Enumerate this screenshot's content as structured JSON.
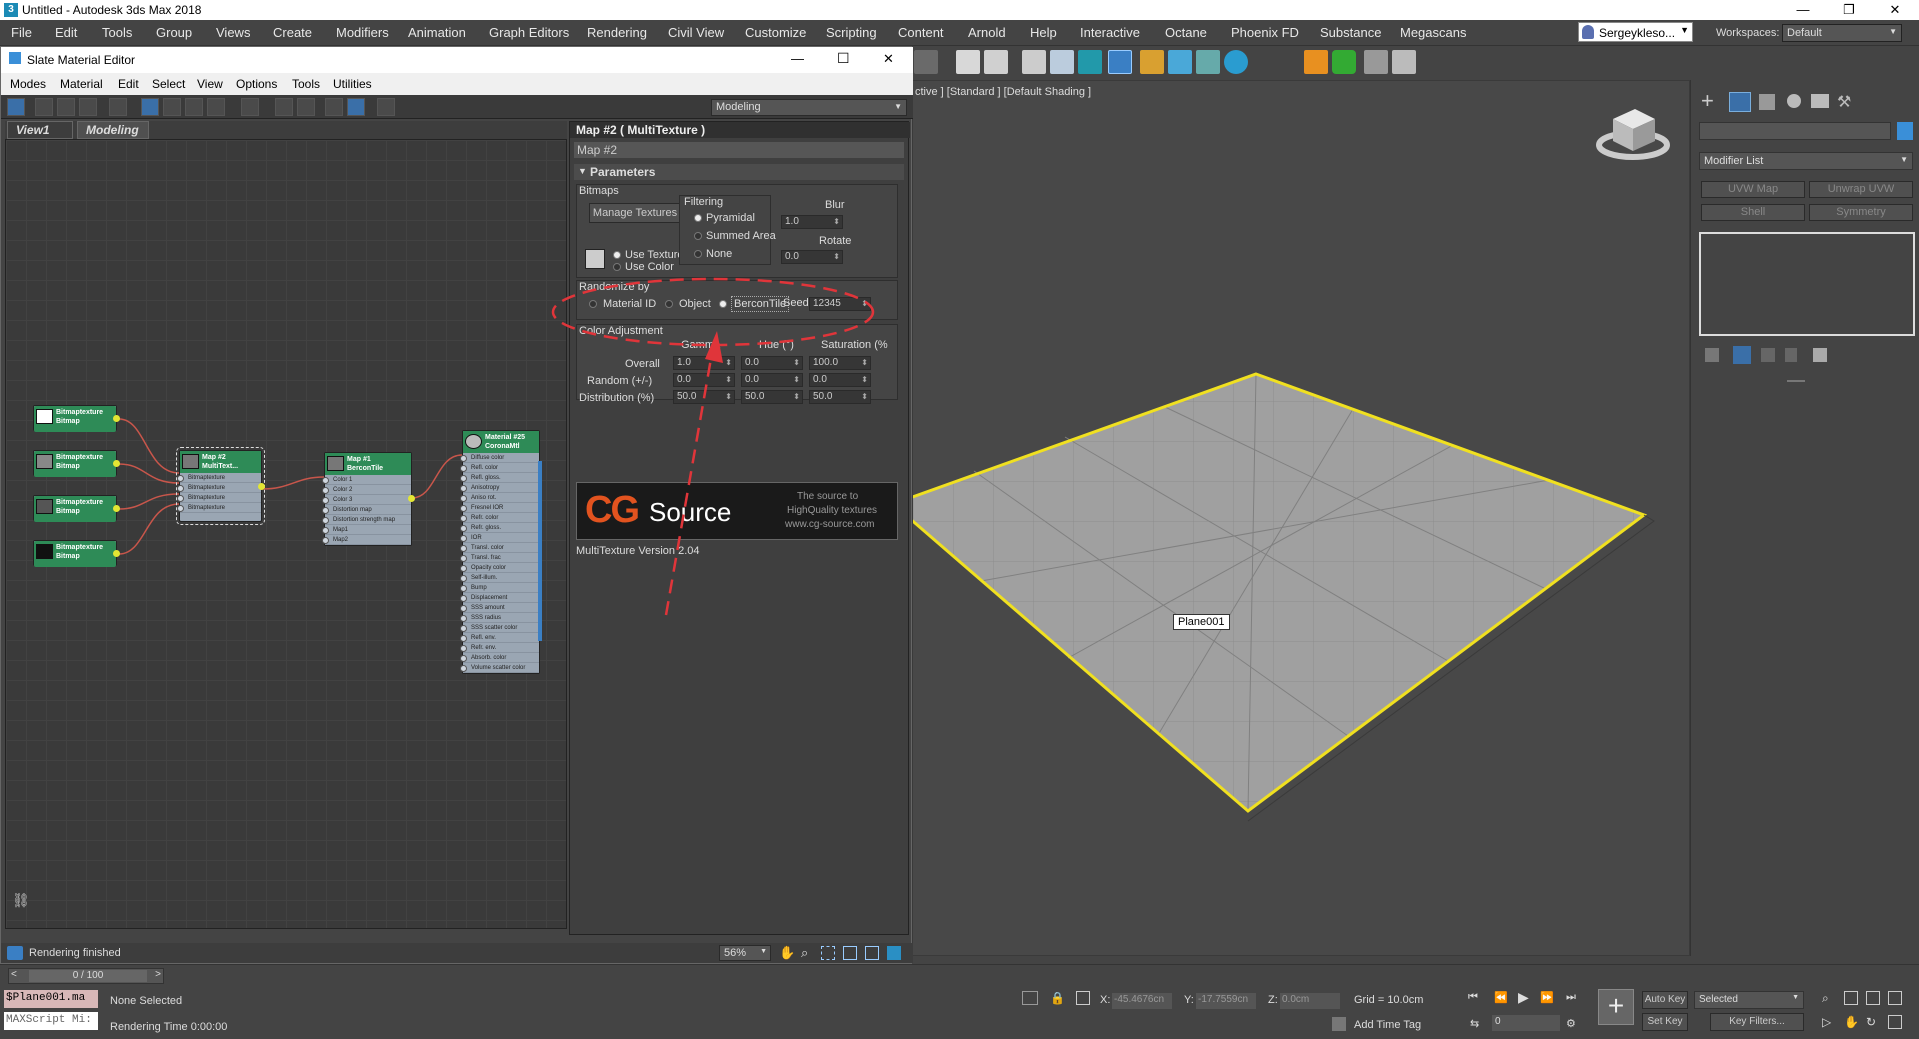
{
  "app": {
    "title": "Untitled - Autodesk 3ds Max 2018",
    "logo": "3",
    "minimize": "—",
    "restore": "❐",
    "close": "✕"
  },
  "menu": [
    "File",
    "Edit",
    "Tools",
    "Group",
    "Views",
    "Create",
    "Modifiers",
    "Animation",
    "Graph Editors",
    "Rendering",
    "Civil View",
    "Customize",
    "Scripting",
    "Content",
    "Arnold",
    "Help",
    "Interactive",
    "Octane",
    "Phoenix FD",
    "Substance",
    "Megascans"
  ],
  "user": {
    "name": "Sergeykleso...",
    "icon": "user-icon"
  },
  "workspaces": {
    "label": "Workspaces:",
    "value": "Default"
  },
  "slate": {
    "title": "Slate Material Editor",
    "minimize": "—",
    "maximize": "☐",
    "close": "✕",
    "menu": [
      "Modes",
      "Material",
      "Edit",
      "Select",
      "View",
      "Options",
      "Tools",
      "Utilities"
    ],
    "view_dropdown": "Modeling",
    "tabs": [
      "View1",
      "Modeling"
    ],
    "status": "Rendering finished",
    "zoom": "56%",
    "nodes": {
      "bitmap_title": "Bitmaptexture",
      "bitmap_sub": "Bitmap",
      "multi_title": "Map #2",
      "multi_sub": "MultiText...",
      "multi_rows": [
        "Bitmaptexture",
        "Bitmaptexture",
        "Bitmaptexture",
        "Bitmaptexture"
      ],
      "bercon_title": "Map #1",
      "bercon_sub": "BerconTile",
      "bercon_rows": [
        "Color 1",
        "Color 2",
        "Color 3",
        "Distortion map",
        "Distortion strength map",
        "Map1",
        "Map2"
      ],
      "corona_title": "Material #25",
      "corona_sub": "CoronaMtl",
      "corona_rows": [
        "Diffuse color",
        "Refl. color",
        "Refl. gloss.",
        "Anisotropy",
        "Aniso rot.",
        "Fresnel IOR",
        "Refr. color",
        "Refr. gloss.",
        "IOR",
        "Transl. color",
        "Transl. frac",
        "Opacity color",
        "Self-illum.",
        "Bump",
        "Displacement",
        "SSS amount",
        "SSS radius",
        "SSS scatter color",
        "Refl. env.",
        "Refr. env.",
        "Absorb. color",
        "Volume scatter color"
      ]
    }
  },
  "params": {
    "header": "Map #2  ( MultiTexture )",
    "name": "Map #2",
    "rollout": "Parameters",
    "bitmaps_label": "Bitmaps",
    "manage_textures": "Manage Textures",
    "use_textures": "Use Textures",
    "use_color": "Use Color",
    "filtering_label": "Filtering",
    "filtering": [
      "Pyramidal",
      "Summed Area",
      "None"
    ],
    "blur_label": "Blur",
    "blur_value": "1.0",
    "rotate_label": "Rotate",
    "rotate_value": "0.0",
    "randomize_label": "Randomize by",
    "randomize": [
      "Material ID",
      "Object",
      "BerconTile"
    ],
    "seed_label": "Seed",
    "seed_value": "12345",
    "color_adj_label": "Color Adjustment",
    "col_headers": [
      "Gamma",
      "Hue (°)",
      "Saturation (%"
    ],
    "rows": [
      {
        "label": "Overall",
        "values": [
          "1.0",
          "0.0",
          "100.0"
        ]
      },
      {
        "label": "Random (+/-)",
        "values": [
          "0.0",
          "0.0",
          "0.0"
        ]
      },
      {
        "label": "Distribution (%)",
        "values": [
          "50.0",
          "50.0",
          "50.0"
        ]
      }
    ],
    "logo_cg": "CG",
    "logo_source": "Source",
    "logo_tag1": "The source to",
    "logo_tag2": "HighQuality textures",
    "logo_url": "www.cg-source.com",
    "version": "MultiTexture Version 2.04",
    "annotation_color": "#e0353a"
  },
  "viewport": {
    "label": "ctive ] [Standard ] [Default Shading ]",
    "object_label": "Plane001",
    "selection_color": "#f0e020"
  },
  "cmdpanel": {
    "modifier_list": "Modifier List",
    "buttons": [
      "UVW Map",
      "Unwrap UVW",
      "Shell",
      "Symmetry"
    ]
  },
  "bottom": {
    "timeline": "0 / 100",
    "script1": "$Plane001.ma",
    "script2": "MAXScript Mi:",
    "selected": "None Selected",
    "render_time": "Rendering Time  0:00:00",
    "x_label": "X:",
    "x_value": "-45.4676cn",
    "y_label": "Y:",
    "y_value": "-17.7559cn",
    "z_label": "Z:",
    "z_value": "0.0cm",
    "grid": "Grid = 10.0cm",
    "add_time_tag": "Add Time Tag",
    "frame": "0",
    "auto_key": "Auto Key",
    "set_key": "Set Key",
    "selected_dropdown": "Selected",
    "key_filters": "Key Filters..."
  }
}
